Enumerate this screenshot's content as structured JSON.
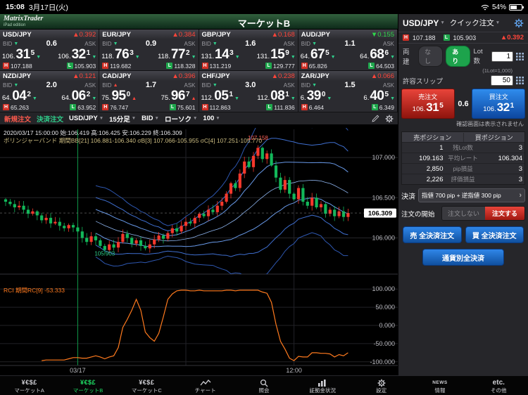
{
  "status_bar": {
    "time": "15:08",
    "date": "3月17日(火)",
    "battery": "54%"
  },
  "header": {
    "logo_line1": "MatrixTrader",
    "logo_line2": "iPad edition",
    "title": "マーケットB"
  },
  "labels": {
    "bid": "BID",
    "ask": "ASK",
    "high": "H",
    "low": "L"
  },
  "rate_panels": [
    {
      "pair": "USD/JPY",
      "change": "▲0.392",
      "dir": "up",
      "tick": "down",
      "bid_prefix": "106.",
      "bid_main": "31",
      "bid_sup": "5",
      "ask_prefix": "106.",
      "ask_main": "32",
      "ask_sup": "1",
      "spread": "0.6",
      "high": "107.188",
      "low": "105.903"
    },
    {
      "pair": "EUR/JPY",
      "change": "▲0.384",
      "dir": "up",
      "tick": "down",
      "bid_prefix": "118.",
      "bid_main": "76",
      "bid_sup": "3",
      "ask_prefix": "118.",
      "ask_main": "77",
      "ask_sup": "2",
      "spread": "0.9",
      "high": "119.682",
      "low": "118.328"
    },
    {
      "pair": "GBP/JPY",
      "change": "▲0.168",
      "dir": "up",
      "tick": "down",
      "bid_prefix": "131.",
      "bid_main": "14",
      "bid_sup": "3",
      "ask_prefix": "131.",
      "ask_main": "15",
      "ask_sup": "9",
      "spread": "1.6",
      "high": "131.219",
      "low": "129.777"
    },
    {
      "pair": "AUD/JPY",
      "change": "▼0.155",
      "dir": "down",
      "tick": "down",
      "bid_prefix": "64.",
      "bid_main": "67",
      "bid_sup": "5",
      "ask_prefix": "64.",
      "ask_main": "68",
      "ask_sup": "6",
      "spread": "1.1",
      "high": "65.826",
      "low": "64.503"
    },
    {
      "pair": "NZD/JPY",
      "change": "▲0.121",
      "dir": "up",
      "tick": "down",
      "bid_prefix": "64.",
      "bid_main": "04",
      "bid_sup": "2",
      "ask_prefix": "64.",
      "ask_main": "06",
      "ask_sup": "2",
      "spread": "2.0",
      "high": "65.263",
      "low": "63.952"
    },
    {
      "pair": "CAD/JPY",
      "change": "▲0.396",
      "dir": "up",
      "tick": "up",
      "bid_prefix": "75.",
      "bid_main": "95",
      "bid_sup": "0",
      "ask_prefix": "75.",
      "ask_main": "96",
      "ask_sup": "7",
      "spread": "1.7",
      "high": "76.747",
      "low": "75.601"
    },
    {
      "pair": "CHF/JPY",
      "change": "▲0.238",
      "dir": "up",
      "tick": "down",
      "bid_prefix": "112.",
      "bid_main": "05",
      "bid_sup": "1",
      "ask_prefix": "112.",
      "ask_main": "08",
      "ask_sup": "1",
      "spread": "3.0",
      "high": "112.863",
      "low": "111.836"
    },
    {
      "pair": "ZAR/JPY",
      "change": "▲0.066",
      "dir": "up",
      "tick": "down",
      "bid_prefix": "6.",
      "bid_main": "39",
      "bid_sup": "0",
      "ask_prefix": "6.",
      "ask_main": "40",
      "ask_sup": "5",
      "spread": "1.5",
      "high": "6.464",
      "low": "6.349"
    }
  ],
  "chart_toolbar": {
    "new_order": "新規注文",
    "close_order": "決済注文",
    "pair": "USD/JPY",
    "timeframe": "15分足",
    "price_type": "BID",
    "chart_type": "ローソク",
    "count": "100"
  },
  "chart": {
    "info_line1": "2020/03/17 15:00:00  始:106.419 高:106.425 安:106.229 終:106.309",
    "info_line2": "ボリンジャーバンド 期間BB[21] 106.881-106.340 σB[3] 107.066-105.955 σC[4] 107.251-105.770",
    "rci_label": "RCI 期間RC[9] -53.333",
    "current_label": "106.309"
  },
  "chart_data": {
    "type": "candlestick",
    "pair": "USD/JPY",
    "timeframe": "15分足",
    "price_source": "BID",
    "title": "USD/JPY 15分足 BID ローソク",
    "ylim": [
      105.55,
      107.35
    ],
    "y_ticks": [
      107.0,
      106.5,
      106.0
    ],
    "current_price": 106.309,
    "rci_ylim": [
      -110,
      110
    ],
    "rci_ticks": [
      100,
      50,
      0,
      -50,
      -100
    ],
    "bollinger_period": 21,
    "rci_period": 9,
    "day_separator_index": 16,
    "minor_separators": [
      40,
      64
    ],
    "x_ticks": [
      {
        "index": 16,
        "label": "03/17"
      },
      {
        "index": 64,
        "label": "12:00"
      }
    ],
    "annotations": [
      {
        "index": 56,
        "price": 107.22,
        "label": "107.158",
        "color": "#ff6157"
      },
      {
        "index": 22,
        "price": 105.78,
        "label": "105.903",
        "color": "#2fd08c"
      }
    ],
    "closes": [
      106.45,
      106.42,
      106.38,
      106.4,
      106.35,
      106.3,
      106.33,
      106.28,
      106.22,
      106.25,
      106.18,
      106.2,
      106.15,
      106.12,
      106.16,
      106.13,
      106.08,
      106.0,
      105.95,
      106.02,
      105.97,
      105.9,
      105.85,
      105.92,
      105.88,
      105.95,
      106.05,
      106.0,
      105.93,
      105.97,
      105.9,
      105.87,
      105.92,
      105.98,
      106.03,
      105.99,
      106.06,
      106.12,
      106.08,
      106.15,
      106.2,
      106.18,
      106.25,
      106.3,
      106.27,
      106.35,
      106.32,
      106.4,
      106.45,
      106.55,
      106.68,
      106.62,
      106.8,
      106.95,
      106.88,
      107.02,
      107.12,
      106.98,
      107.05,
      106.9,
      106.75,
      106.6,
      106.72,
      106.55,
      106.48,
      106.62,
      106.45,
      106.4,
      106.5,
      106.38,
      106.42,
      106.3,
      106.35,
      106.27,
      106.33,
      106.26,
      106.31
    ]
  },
  "order_panel": {
    "pair": "USD/JPY",
    "order_type": "クイック注文",
    "high": "107.188",
    "low": "105.903",
    "change": "▲0.392",
    "hedge_label": "両建",
    "hedge_off": "なし",
    "hedge_on": "あり",
    "lot_label": "Lot数",
    "lot_value": "1",
    "lot_note": "(1Lot=1,000)",
    "slip_label": "許容スリップ",
    "slip_value": "50",
    "sell_label": "売注文",
    "sell_prefix": "106.",
    "sell_main": "31",
    "sell_sup": "5",
    "spread": "0.6",
    "buy_label": "買注文",
    "buy_prefix": "106.",
    "buy_main": "32",
    "buy_sup": "1",
    "confirm_note": "確認画面は表示されません",
    "positions": {
      "sell_header": "売ポジション",
      "buy_header": "買ポジション",
      "rows": [
        {
          "label": "残Lot数",
          "sell": "1",
          "buy": "3"
        },
        {
          "label": "平均レート",
          "sell": "109.163",
          "buy": "106.304"
        },
        {
          "label": "pip損益",
          "sell": "2,850",
          "buy": "3"
        },
        {
          "label": "評価損益",
          "sell": "2,226",
          "buy": "3"
        }
      ]
    },
    "settle_label": "決済",
    "settle_value": "指値 700 pip + 逆指値 300 pip",
    "order_start_label": "注文の開始",
    "order_off": "注文しない",
    "order_on": "注文する",
    "sell_close_all": "売 全決済注文",
    "buy_close_all": "買 全決済注文",
    "close_by_pair": "通貨別全決済"
  },
  "bottom_nav": [
    {
      "label": "マーケットA",
      "icon": "currency-symbols-icon",
      "icon_text": "¥€$£",
      "selected": false
    },
    {
      "label": "マーケットB",
      "icon": "currency-symbols-icon",
      "icon_text": "¥€$£",
      "selected": true
    },
    {
      "label": "マーケットC",
      "icon": "currency-symbols-icon",
      "icon_text": "¥€$£",
      "selected": false
    },
    {
      "label": "チャート",
      "icon": "chart-line-icon",
      "icon_text": "",
      "selected": false
    },
    {
      "label": "照会",
      "icon": "search-icon",
      "icon_text": "",
      "selected": false
    },
    {
      "label": "証拠金状況",
      "icon": "margin-status-icon",
      "icon_text": "",
      "selected": false
    },
    {
      "label": "設定",
      "icon": "gear-icon",
      "icon_text": "",
      "selected": false
    },
    {
      "label": "情報",
      "icon": "news-icon",
      "icon_text": "NEWS",
      "selected": false
    },
    {
      "label": "その他",
      "icon": "etc-icon",
      "icon_text": "etc.",
      "selected": false
    }
  ]
}
